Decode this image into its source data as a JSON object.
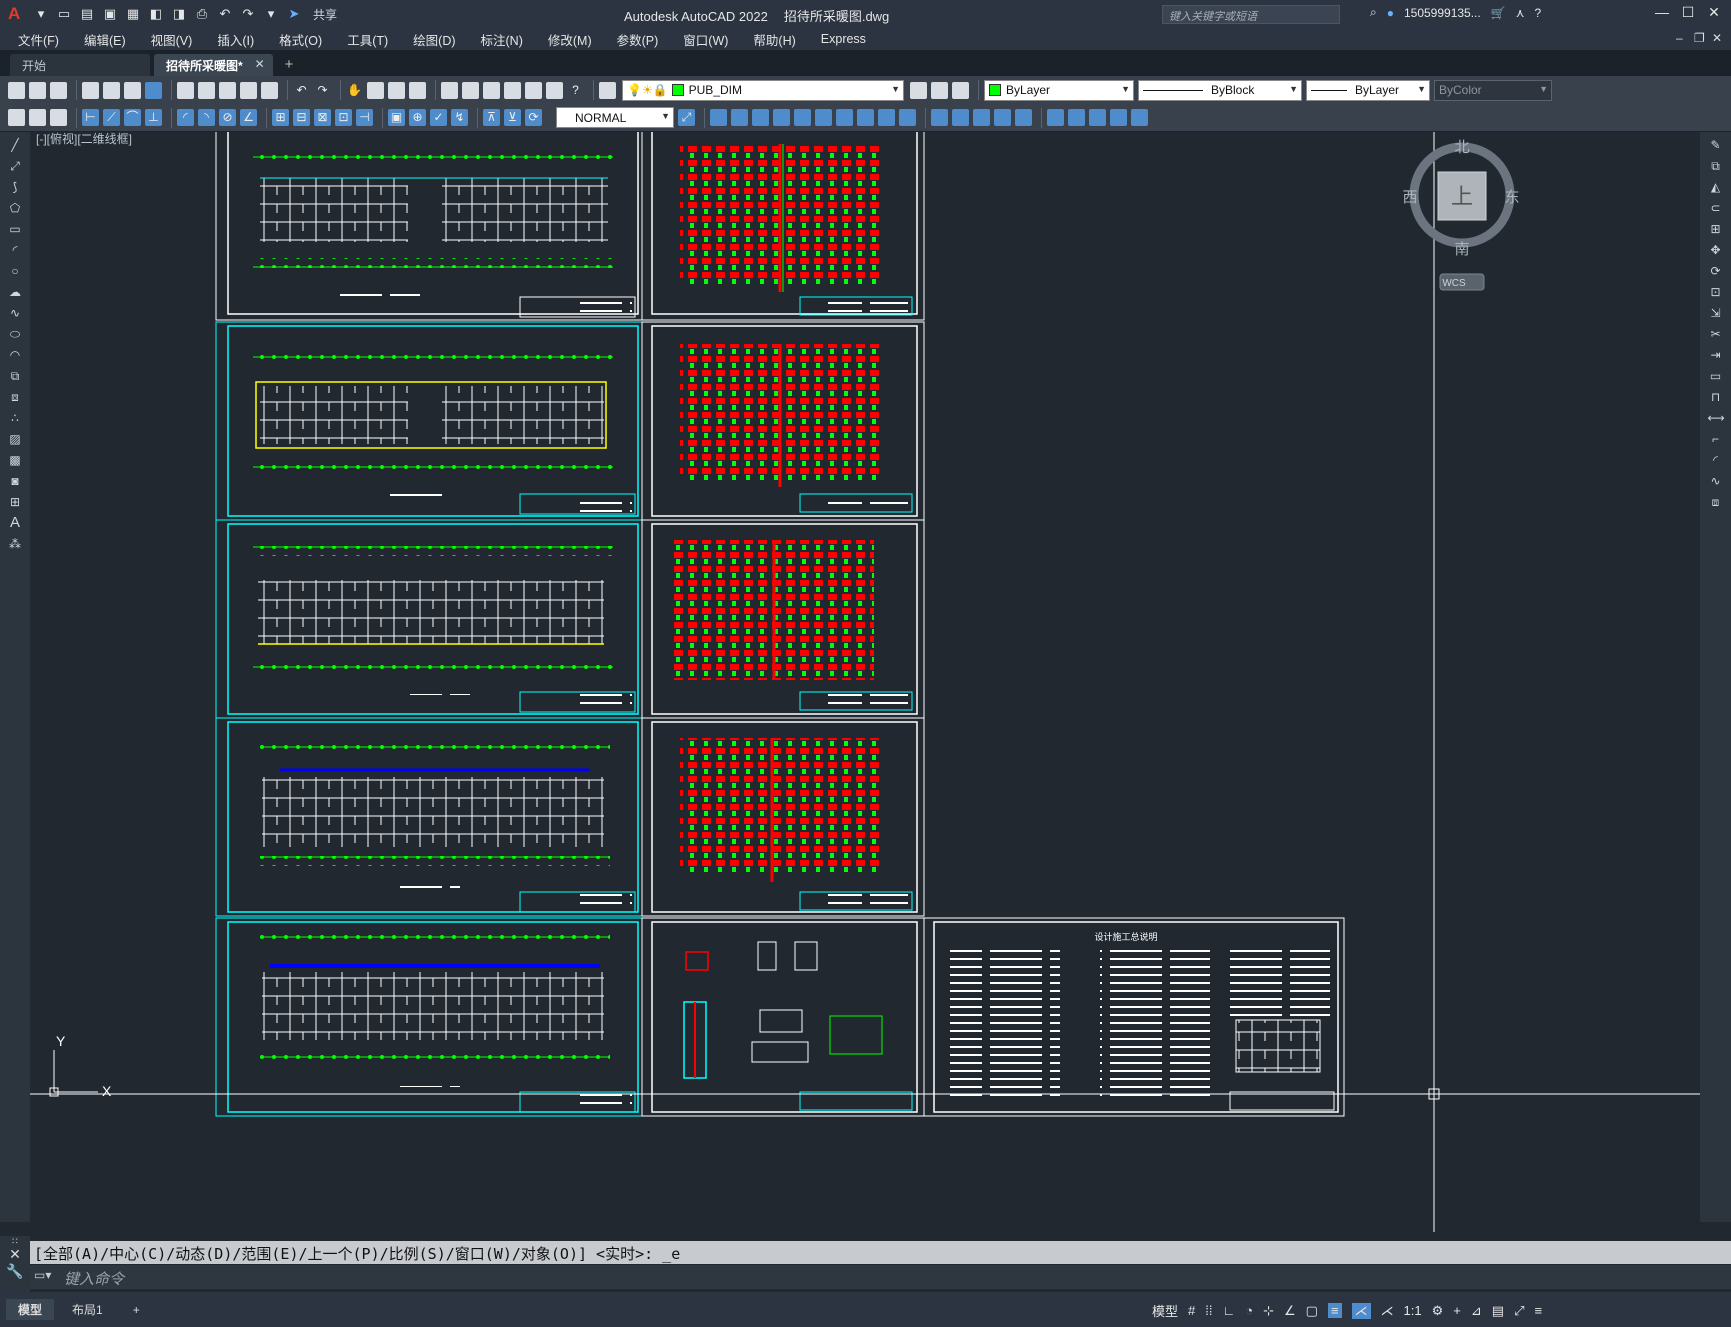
{
  "title": {
    "app": "Autodesk AutoCAD 2022",
    "file": "招待所采暖图.dwg",
    "share_label": "共享"
  },
  "search": {
    "placeholder": "键入关键字或短语"
  },
  "user": {
    "name": "1505999135..."
  },
  "menus": [
    "文件(F)",
    "编辑(E)",
    "视图(V)",
    "插入(I)",
    "格式(O)",
    "工具(T)",
    "绘图(D)",
    "标注(N)",
    "修改(M)",
    "参数(P)",
    "窗口(W)",
    "帮助(H)",
    "Express"
  ],
  "file_tabs": [
    {
      "label": "开始"
    },
    {
      "label": "招待所采暖图*"
    }
  ],
  "layer": {
    "name": "PUB_DIM",
    "color": "#00ff00"
  },
  "properties": {
    "color": "ByLayer",
    "linetype": "ByBlock",
    "lineweight": "ByLayer",
    "plotstyle": "ByColor"
  },
  "textstyle": {
    "name": "NORMAL"
  },
  "viewport": {
    "label": "[-][俯视][二维线框]"
  },
  "viewcube": {
    "top": "上",
    "north": "北",
    "south": "南",
    "east": "东",
    "west": "西",
    "wcs": "WCS"
  },
  "ucs": {
    "x": "X",
    "y": "Y"
  },
  "drawing": {
    "notes_title": "设计施工总说明"
  },
  "command": {
    "history": "[全部(A)/中心(C)/动态(D)/范围(E)/上一个(P)/比例(S)/窗口(W)/对象(O)] <实时>: _e",
    "placeholder": "键入命令"
  },
  "layout_tabs": [
    "模型",
    "布局1"
  ],
  "status": {
    "model": "模型",
    "scale": "1:1"
  },
  "colors": {
    "background": "#212830",
    "ui": "#2b3440",
    "pipe": "#ff0000",
    "radiator": "#00ff00",
    "walls": "#ffffff",
    "sheet_cyan": "#00ffff"
  }
}
